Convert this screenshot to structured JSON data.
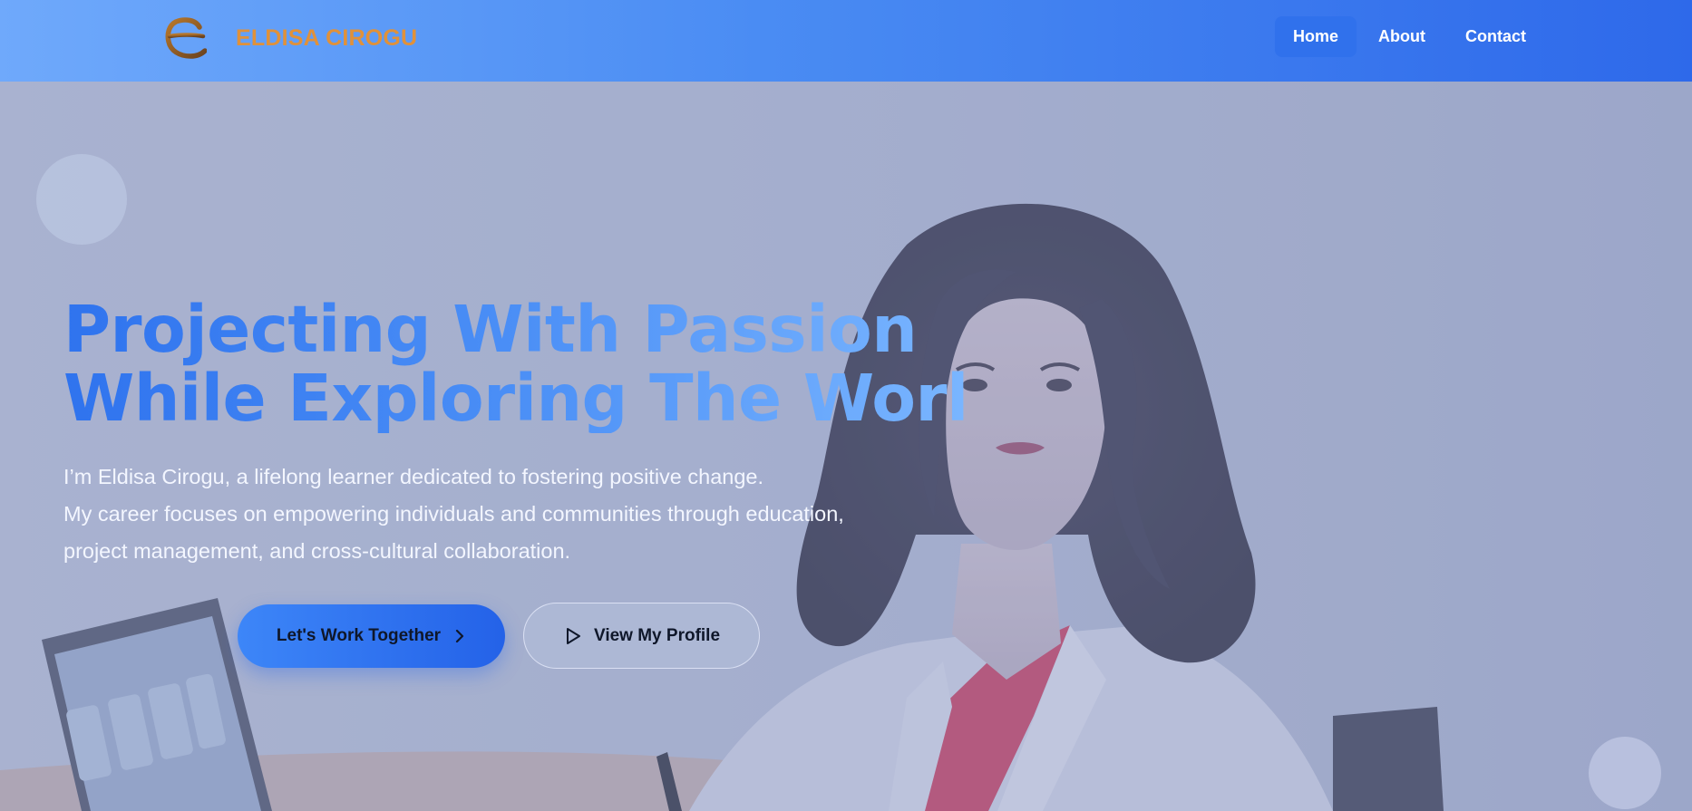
{
  "header": {
    "brand_name": "ELDISA CIROGU",
    "nav": [
      {
        "label": "Home",
        "active": true
      },
      {
        "label": "About",
        "active": false
      },
      {
        "label": "Contact",
        "active": false
      }
    ]
  },
  "hero": {
    "headline_lines": [
      "Projecting With Passion",
      "While Exploring The World"
    ],
    "intro_lines": [
      "I’m Eldisa Cirogu, a lifelong learner dedicated to fostering positive change.",
      "My career focuses on empowering individuals and communities through education,",
      "project management, and cross-cultural collaboration."
    ],
    "primary_cta": {
      "label": "Let's Work Together",
      "icon": "chevron-right-icon"
    },
    "secondary_cta": {
      "label": "View My Profile",
      "icon": "play-icon"
    }
  },
  "colors": {
    "header_gradient_start": "#6fa9fb",
    "header_gradient_end": "#2e69ea",
    "brand": "#e0913a",
    "nav_active_bg": "#3071ec",
    "headline_gradient_start": "#2f73ee",
    "headline_gradient_end": "#7ab6ff",
    "primary_button": "#2563eb"
  }
}
